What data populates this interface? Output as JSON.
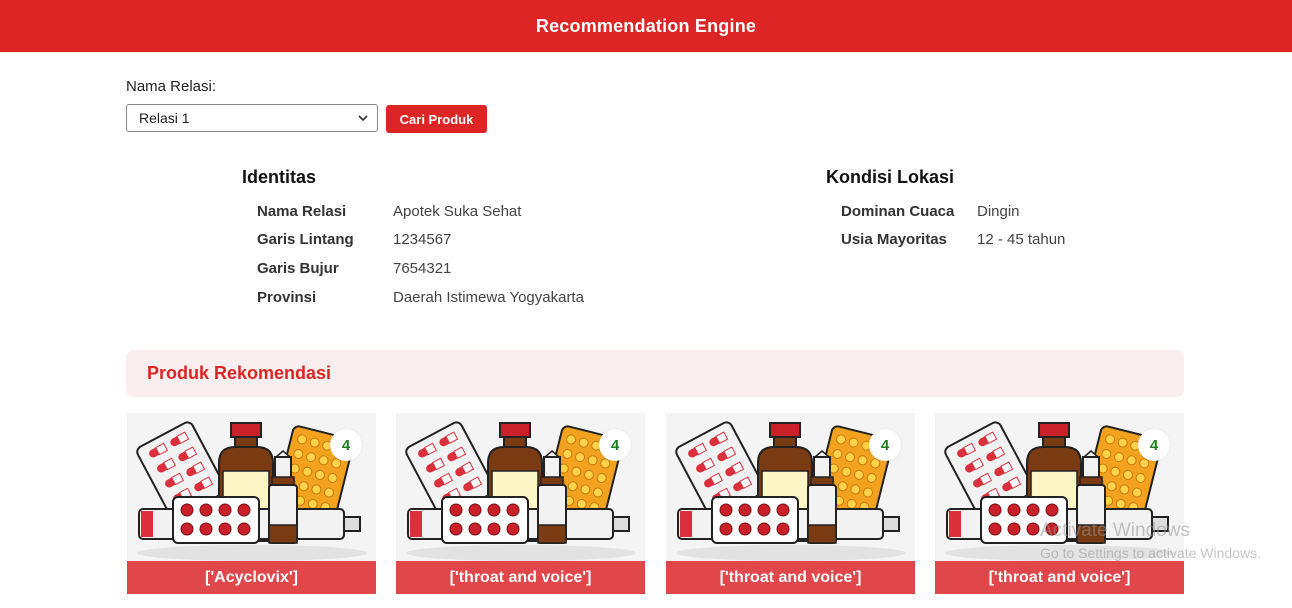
{
  "app": {
    "title": "Recommendation Engine"
  },
  "form": {
    "label": "Nama Relasi:",
    "selected": "Relasi 1",
    "button": "Cari Produk"
  },
  "identitas": {
    "title": "Identitas",
    "rows": [
      {
        "key": "Nama Relasi",
        "value": "Apotek Suka Sehat"
      },
      {
        "key": "Garis Lintang",
        "value": "1234567"
      },
      {
        "key": "Garis Bujur",
        "value": "7654321"
      },
      {
        "key": "Provinsi",
        "value": "Daerah Istimewa Yogyakarta"
      }
    ]
  },
  "lokasi": {
    "title": "Kondisi Lokasi",
    "rows": [
      {
        "key": "Dominan Cuaca",
        "value": "Dingin"
      },
      {
        "key": "Usia Mayoritas",
        "value": "12 - 45 tahun"
      }
    ]
  },
  "recommendations": {
    "title": "Produk Rekomendasi",
    "products": [
      {
        "name": "['Acyclovix']",
        "score": "4"
      },
      {
        "name": "['throat and voice']",
        "score": "4"
      },
      {
        "name": "['throat and voice']",
        "score": "4"
      },
      {
        "name": "['throat and voice']",
        "score": "4"
      }
    ]
  },
  "watermark": {
    "line1": "Activate Windows",
    "line2": "Go to Settings to activate Windows."
  },
  "colors": {
    "primary": "#de2526",
    "card_label": "#e0474b",
    "score": "#1a7f1a",
    "rec_bar": "#fbeeee"
  }
}
